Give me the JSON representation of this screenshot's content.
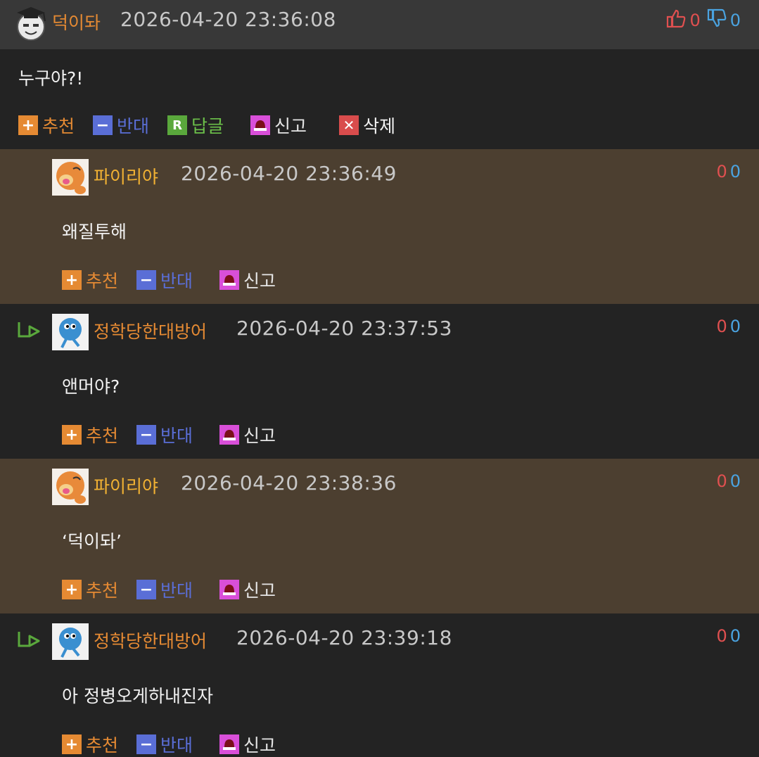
{
  "thread": {
    "main": {
      "nickname": "덕이돠",
      "timestamp": "2026-04-20 23:36:08",
      "upvotes": "0",
      "downvotes": "0",
      "text": "누구야?!",
      "actions": {
        "up": "추천",
        "down": "반대",
        "reply": "답글",
        "report": "신고",
        "delete": "삭제"
      }
    },
    "replies": [
      {
        "nickname": "파이리야",
        "timestamp": "2026-04-20 23:36:49",
        "upvotes": "0",
        "downvotes": "0",
        "text": "왜질투해",
        "up": "추천",
        "down": "반대",
        "report": "신고"
      },
      {
        "nickname": "정학당한대방어",
        "timestamp": "2026-04-20 23:37:53",
        "upvotes": "0",
        "downvotes": "0",
        "text": "앤머야?",
        "up": "추천",
        "down": "반대",
        "report": "신고"
      },
      {
        "nickname": "파이리야",
        "timestamp": "2026-04-20 23:38:36",
        "upvotes": "0",
        "downvotes": "0",
        "text": "‘덕이돠’",
        "up": "추천",
        "down": "반대",
        "report": "신고"
      },
      {
        "nickname": "정학당한대방어",
        "timestamp": "2026-04-20 23:39:18",
        "upvotes": "0",
        "downvotes": "0",
        "text": "아 정병오게하내진자",
        "up": "추천",
        "down": "반대",
        "report": "신고"
      }
    ]
  },
  "icons": {
    "plus": "plus-icon",
    "minus": "minus-icon",
    "reply": "reply-icon",
    "report": "siren-icon",
    "delete": "close-icon",
    "thumbs_up": "thumbs-up-icon",
    "thumbs_down": "thumbs-down-icon",
    "nested": "reply-arrow-icon"
  },
  "colors": {
    "nick_orange": "#e58a33",
    "nick_yellow": "#f2b233",
    "up_red": "#e05050",
    "down_blue": "#4aa3e0",
    "bg_dark": "#232323",
    "bg_brown": "#4c3f30",
    "header_gray": "#383838"
  }
}
